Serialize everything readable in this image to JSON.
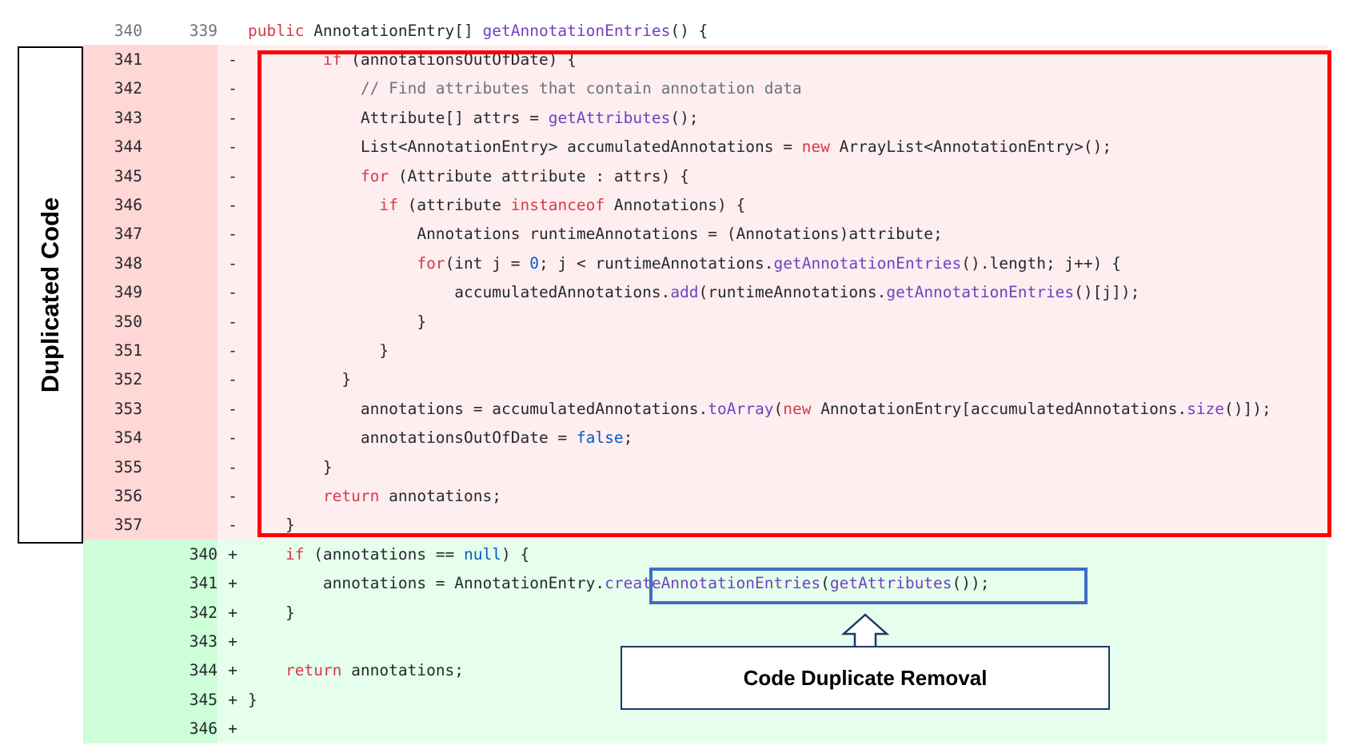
{
  "diff": {
    "rows": [
      {
        "type": "ctx",
        "old": "340",
        "new": "339",
        "sign": "",
        "indent": "",
        "tokens": [
          [
            "kw",
            "public"
          ],
          [
            "tx",
            " AnnotationEntry[] "
          ],
          [
            "fn",
            "getAnnotationEntries"
          ],
          [
            "tx",
            "() {"
          ]
        ]
      },
      {
        "type": "del",
        "old": "341",
        "new": "",
        "sign": "-",
        "indent": "        ",
        "tokens": [
          [
            "kw",
            "if"
          ],
          [
            "tx",
            " (annotationsOutOfDate) {"
          ]
        ]
      },
      {
        "type": "del",
        "old": "342",
        "new": "",
        "sign": "-",
        "indent": "            ",
        "tokens": [
          [
            "cm",
            "// Find attributes that contain annotation data"
          ]
        ]
      },
      {
        "type": "del",
        "old": "343",
        "new": "",
        "sign": "-",
        "indent": "            ",
        "tokens": [
          [
            "tx",
            "Attribute[] attrs = "
          ],
          [
            "fn",
            "getAttributes"
          ],
          [
            "tx",
            "();"
          ]
        ]
      },
      {
        "type": "del",
        "old": "344",
        "new": "",
        "sign": "-",
        "indent": "            ",
        "tokens": [
          [
            "tx",
            "List<AnnotationEntry> accumulatedAnnotations = "
          ],
          [
            "kw",
            "new"
          ],
          [
            "tx",
            " ArrayList<AnnotationEntry>();"
          ]
        ]
      },
      {
        "type": "del",
        "old": "345",
        "new": "",
        "sign": "-",
        "indent": "            ",
        "tokens": [
          [
            "kw",
            "for"
          ],
          [
            "tx",
            " (Attribute attribute : attrs) {"
          ]
        ]
      },
      {
        "type": "del",
        "old": "346",
        "new": "",
        "sign": "-",
        "indent": "              ",
        "tokens": [
          [
            "kw",
            "if"
          ],
          [
            "tx",
            " (attribute "
          ],
          [
            "kw",
            "instanceof"
          ],
          [
            "tx",
            " Annotations) {"
          ]
        ]
      },
      {
        "type": "del",
        "old": "347",
        "new": "",
        "sign": "-",
        "indent": "                  ",
        "tokens": [
          [
            "tx",
            "Annotations runtimeAnnotations = (Annotations)attribute;"
          ]
        ]
      },
      {
        "type": "del",
        "old": "348",
        "new": "",
        "sign": "-",
        "indent": "                  ",
        "tokens": [
          [
            "kw",
            "for"
          ],
          [
            "tx",
            "(int j = "
          ],
          [
            "lit",
            "0"
          ],
          [
            "tx",
            "; j < runtimeAnnotations."
          ],
          [
            "fn",
            "getAnnotationEntries"
          ],
          [
            "tx",
            "().length; j++) {"
          ]
        ]
      },
      {
        "type": "del",
        "old": "349",
        "new": "",
        "sign": "-",
        "indent": "                      ",
        "tokens": [
          [
            "tx",
            "accumulatedAnnotations."
          ],
          [
            "fn",
            "add"
          ],
          [
            "tx",
            "(runtimeAnnotations."
          ],
          [
            "fn",
            "getAnnotationEntries"
          ],
          [
            "tx",
            "()[j]);"
          ]
        ]
      },
      {
        "type": "del",
        "old": "350",
        "new": "",
        "sign": "-",
        "indent": "                  ",
        "tokens": [
          [
            "tx",
            "}"
          ]
        ]
      },
      {
        "type": "del",
        "old": "351",
        "new": "",
        "sign": "-",
        "indent": "              ",
        "tokens": [
          [
            "tx",
            "}"
          ]
        ]
      },
      {
        "type": "del",
        "old": "352",
        "new": "",
        "sign": "-",
        "indent": "          ",
        "tokens": [
          [
            "tx",
            "}"
          ]
        ]
      },
      {
        "type": "del",
        "old": "353",
        "new": "",
        "sign": "-",
        "indent": "            ",
        "tokens": [
          [
            "tx",
            "annotations = accumulatedAnnotations."
          ],
          [
            "fn",
            "toArray"
          ],
          [
            "tx",
            "("
          ],
          [
            "kw",
            "new"
          ],
          [
            "tx",
            " AnnotationEntry[accumulatedAnnotations."
          ],
          [
            "fn",
            "size"
          ],
          [
            "tx",
            "()]);"
          ]
        ]
      },
      {
        "type": "del",
        "old": "354",
        "new": "",
        "sign": "-",
        "indent": "            ",
        "tokens": [
          [
            "tx",
            "annotationsOutOfDate = "
          ],
          [
            "lit",
            "false"
          ],
          [
            "tx",
            ";"
          ]
        ]
      },
      {
        "type": "del",
        "old": "355",
        "new": "",
        "sign": "-",
        "indent": "        ",
        "tokens": [
          [
            "tx",
            "}"
          ]
        ]
      },
      {
        "type": "del",
        "old": "356",
        "new": "",
        "sign": "-",
        "indent": "        ",
        "tokens": [
          [
            "kw",
            "return"
          ],
          [
            "tx",
            " annotations;"
          ]
        ]
      },
      {
        "type": "del",
        "old": "357",
        "new": "",
        "sign": "-",
        "indent": "    ",
        "tokens": [
          [
            "tx",
            "}"
          ]
        ]
      },
      {
        "type": "add",
        "old": "",
        "new": "340",
        "sign": "+",
        "indent": "    ",
        "tokens": [
          [
            "kw",
            "if"
          ],
          [
            "tx",
            " (annotations == "
          ],
          [
            "lit",
            "null"
          ],
          [
            "tx",
            ") {"
          ]
        ]
      },
      {
        "type": "add",
        "old": "",
        "new": "341",
        "sign": "+",
        "indent": "        ",
        "tokens": [
          [
            "tx",
            "annotations = AnnotationEntry."
          ],
          [
            "fn",
            "createAnnotationEntries"
          ],
          [
            "tx",
            "("
          ],
          [
            "fn",
            "getAttributes"
          ],
          [
            "tx",
            "());"
          ]
        ]
      },
      {
        "type": "add",
        "old": "",
        "new": "342",
        "sign": "+",
        "indent": "    ",
        "tokens": [
          [
            "tx",
            "}"
          ]
        ]
      },
      {
        "type": "add",
        "old": "",
        "new": "343",
        "sign": "+",
        "indent": "",
        "tokens": []
      },
      {
        "type": "add",
        "old": "",
        "new": "344",
        "sign": "+",
        "indent": "    ",
        "tokens": [
          [
            "kw",
            "return"
          ],
          [
            "tx",
            " annotations;"
          ]
        ]
      },
      {
        "type": "add",
        "old": "",
        "new": "345",
        "sign": "+",
        "indent": "",
        "tokens": [
          [
            "tx",
            "}"
          ]
        ]
      },
      {
        "type": "add",
        "old": "",
        "new": "346",
        "sign": "+",
        "indent": "",
        "tokens": []
      }
    ]
  },
  "annotations": {
    "duplicated_label": "Duplicated Code",
    "removal_label": "Code Duplicate Removal"
  },
  "colors": {
    "highlight_red": "#ff0000",
    "highlight_blue": "#3f6fc4",
    "deleted_bg": "#ffeef0",
    "added_bg": "#e6ffec"
  }
}
